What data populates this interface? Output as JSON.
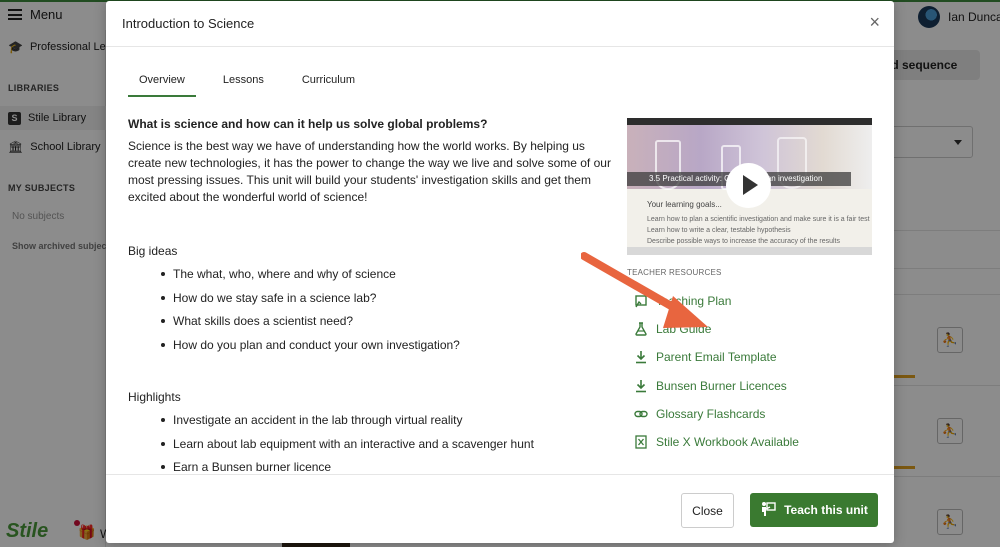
{
  "topbar": {
    "menu_label": "Menu",
    "user_name": "Ian Duncan"
  },
  "sidebar": {
    "professional_label": "Professional Lea",
    "libraries_heading": "LIBRARIES",
    "stile_library": "Stile Library",
    "school_library": "School Library",
    "my_subjects_heading": "MY SUBJECTS",
    "no_subjects": "No subjects",
    "show_archived": "Show archived subjects",
    "logo": "Stile",
    "gift_label": "W"
  },
  "background": {
    "sequence_button": "nd sequence"
  },
  "modal": {
    "title": "Introduction to Science",
    "close_glyph": "×",
    "tabs": [
      {
        "label": "Overview"
      },
      {
        "label": "Lessons"
      },
      {
        "label": "Curriculum"
      }
    ],
    "question": "What is science and how can it help us solve global problems?",
    "description": "Science is the best way we have of understanding how the world works. By helping us create new technologies, it has the power to change the way we live and solve some of our most pressing issues. This unit will build your students' investigation skills and get them excited about the wonderful world of science!",
    "big_ideas_heading": "Big ideas",
    "big_ideas": [
      "The what, who, where and why of science",
      "How do we stay safe in a science lab?",
      "What skills does a scientist need?",
      "How do you plan and conduct your own investigation?"
    ],
    "highlights_heading": "Highlights",
    "highlights": [
      "Investigate an accident in the lab through virtual reality",
      "Learn about lab equipment with an interactive and a scavenger hunt",
      "Earn a Bunsen burner licence"
    ],
    "video": {
      "caption": "3.5 Practical activity: Conducting an investigation",
      "goals_heading": "Your learning goals...",
      "goals": [
        "Learn how to plan a scientific investigation and make sure it is a fair test",
        "Learn how to write a clear, testable hypothesis",
        "Describe possible ways to increase the accuracy of the results"
      ]
    },
    "teacher_resources_heading": "TEACHER RESOURCES",
    "resources": [
      {
        "label": "Teaching Plan",
        "icon": "teaching-plan-icon"
      },
      {
        "label": "Lab Guide",
        "icon": "flask-icon"
      },
      {
        "label": "Parent Email Template",
        "icon": "download-icon"
      },
      {
        "label": "Bunsen Burner Licences",
        "icon": "download-icon"
      },
      {
        "label": "Glossary Flashcards",
        "icon": "link-icon"
      },
      {
        "label": "Stile X Workbook Available",
        "icon": "excel-icon"
      }
    ],
    "close_button": "Close",
    "teach_button": "Teach this unit"
  },
  "colors": {
    "accent": "#3a7a30",
    "link": "#3a7a3a",
    "arrow": "#e8653f",
    "progress": "#e0a020"
  }
}
